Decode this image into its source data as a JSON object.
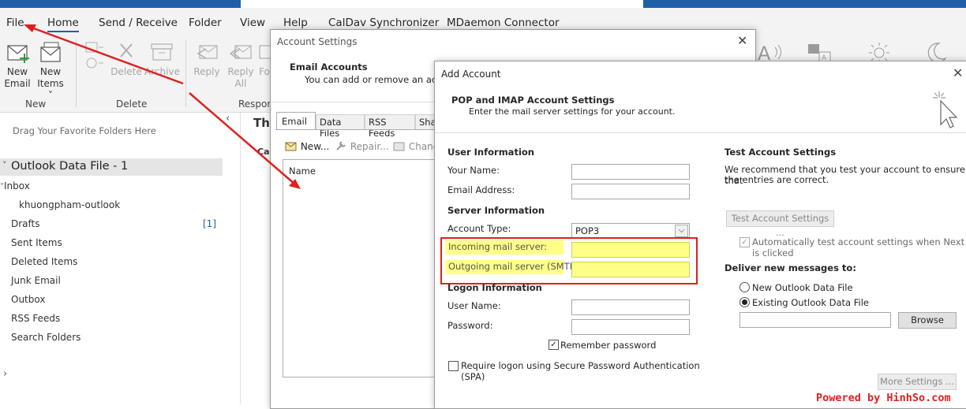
{
  "menu": {
    "tabs": [
      {
        "label": "File"
      },
      {
        "label": "Home"
      },
      {
        "label": "Send / Receive"
      },
      {
        "label": "Folder"
      },
      {
        "label": "View"
      },
      {
        "label": "Help"
      },
      {
        "label": "CalDav Synchronizer"
      },
      {
        "label": "MDaemon Connector"
      }
    ]
  },
  "ribbon": {
    "new_email": [
      "New",
      "Email"
    ],
    "new_items": [
      "New",
      "Items ˅"
    ],
    "delete": "Delete",
    "archive": "Archive",
    "reply": "Reply",
    "reply_all": [
      "Reply",
      "All"
    ],
    "forward_partial": "Fo",
    "groups": {
      "new": "New",
      "delete": "Delete",
      "respond": "Respon"
    }
  },
  "folder_pane": {
    "hint": "Drag Your Favorite Folders Here",
    "data_file": "Outlook Data File - 1",
    "folders": [
      {
        "label": "Inbox"
      },
      {
        "label": "khuongpham-outlook"
      },
      {
        "label": "Drafts",
        "count": "[1]"
      },
      {
        "label": "Sent Items"
      },
      {
        "label": "Deleted Items"
      },
      {
        "label": "Junk Email"
      },
      {
        "label": "Outbox"
      },
      {
        "label": "RSS Feeds"
      },
      {
        "label": "Search Folders"
      }
    ]
  },
  "middle": {
    "heading": "Thu",
    "sub": "Cal"
  },
  "account_settings": {
    "title": "Account Settings",
    "section_title": "Email Accounts",
    "section_desc": "You can add or remove an accou",
    "tabs": [
      "Email",
      "Data Files",
      "RSS Feeds",
      "Sha"
    ],
    "toolbar": {
      "new": "New...",
      "repair": "Repair...",
      "change": "Chang"
    },
    "list_header": "Name"
  },
  "add_account": {
    "title": "Add Account",
    "header_title": "POP and IMAP Account Settings",
    "header_desc": "Enter the mail server settings for your account.",
    "user_info": "User Information",
    "your_name": "Your Name:",
    "email_address": "Email Address:",
    "server_info": "Server Information",
    "account_type": "Account Type:",
    "account_type_value": "POP3",
    "incoming": "Incoming mail server:",
    "outgoing": "Outgoing mail server (SMTP):",
    "logon_info": "Logon Information",
    "user_name": "User Name:",
    "password": "Password:",
    "remember_password": "Remember password",
    "spa": "Require logon using Secure Password Authentication",
    "spa2": "(SPA)",
    "test_title": "Test Account Settings",
    "test_desc1": "We recommend that you test your account to ensure that",
    "test_desc2": "the entries are correct.",
    "test_button": "Test Account Settings ...",
    "auto_test1": "Automatically test account settings when Next",
    "auto_test2": "is clicked",
    "deliver_title": "Deliver new messages to:",
    "new_data_file": "New Outlook Data File",
    "existing_data_file": "Existing Outlook Data File",
    "browse": "Browse",
    "more_settings": "More Settings ..."
  },
  "watermark": "Powered by HinhSo.com",
  "colors": {
    "accent": "#1f5fa8",
    "highlight_box": "#e02020",
    "highlight_fill": "#ffff88",
    "arrow": "#e02020",
    "watermark": "#e02020"
  }
}
